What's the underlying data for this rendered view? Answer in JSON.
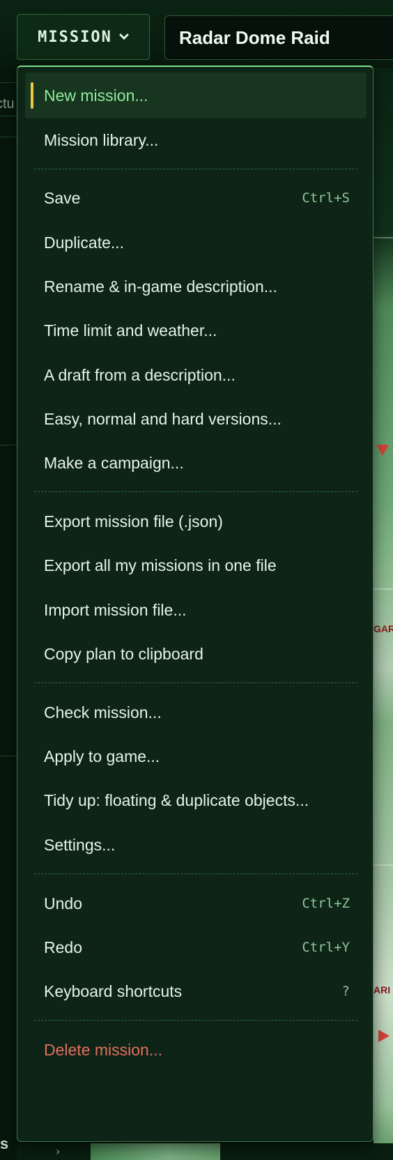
{
  "header": {
    "menu_button_label": "MISSION",
    "mission_title": "Radar Dome Raid"
  },
  "background": {
    "left_panel_fragment": "ctu",
    "left_bottom_label": "s",
    "map_tag_1": "GAR",
    "map_tag_2": "ARI"
  },
  "menu": {
    "items": [
      {
        "label": "New mission...",
        "shortcut": ""
      },
      {
        "label": "Mission library...",
        "shortcut": ""
      },
      {
        "label": "Save",
        "shortcut": "Ctrl+S"
      },
      {
        "label": "Duplicate...",
        "shortcut": ""
      },
      {
        "label": "Rename & in-game description...",
        "shortcut": ""
      },
      {
        "label": "Time limit and weather...",
        "shortcut": ""
      },
      {
        "label": "A draft from a description...",
        "shortcut": ""
      },
      {
        "label": "Easy, normal and hard versions...",
        "shortcut": ""
      },
      {
        "label": "Make a campaign...",
        "shortcut": ""
      },
      {
        "label": "Export mission file (.json)",
        "shortcut": ""
      },
      {
        "label": "Export all my missions in one file",
        "shortcut": ""
      },
      {
        "label": "Import mission file...",
        "shortcut": ""
      },
      {
        "label": "Copy plan to clipboard",
        "shortcut": ""
      },
      {
        "label": "Check mission...",
        "shortcut": ""
      },
      {
        "label": "Apply to game...",
        "shortcut": ""
      },
      {
        "label": "Tidy up: floating & duplicate objects...",
        "shortcut": ""
      },
      {
        "label": "Settings...",
        "shortcut": ""
      },
      {
        "label": "Undo",
        "shortcut": "Ctrl+Z"
      },
      {
        "label": "Redo",
        "shortcut": "Ctrl+Y"
      },
      {
        "label": "Keyboard shortcuts",
        "shortcut": "?"
      },
      {
        "label": "Delete mission...",
        "shortcut": ""
      }
    ]
  },
  "colors": {
    "accent": "#8fec9c",
    "active_marker": "#ebc84a",
    "danger": "#e46f5f",
    "menu_bg": "#0d2416"
  }
}
